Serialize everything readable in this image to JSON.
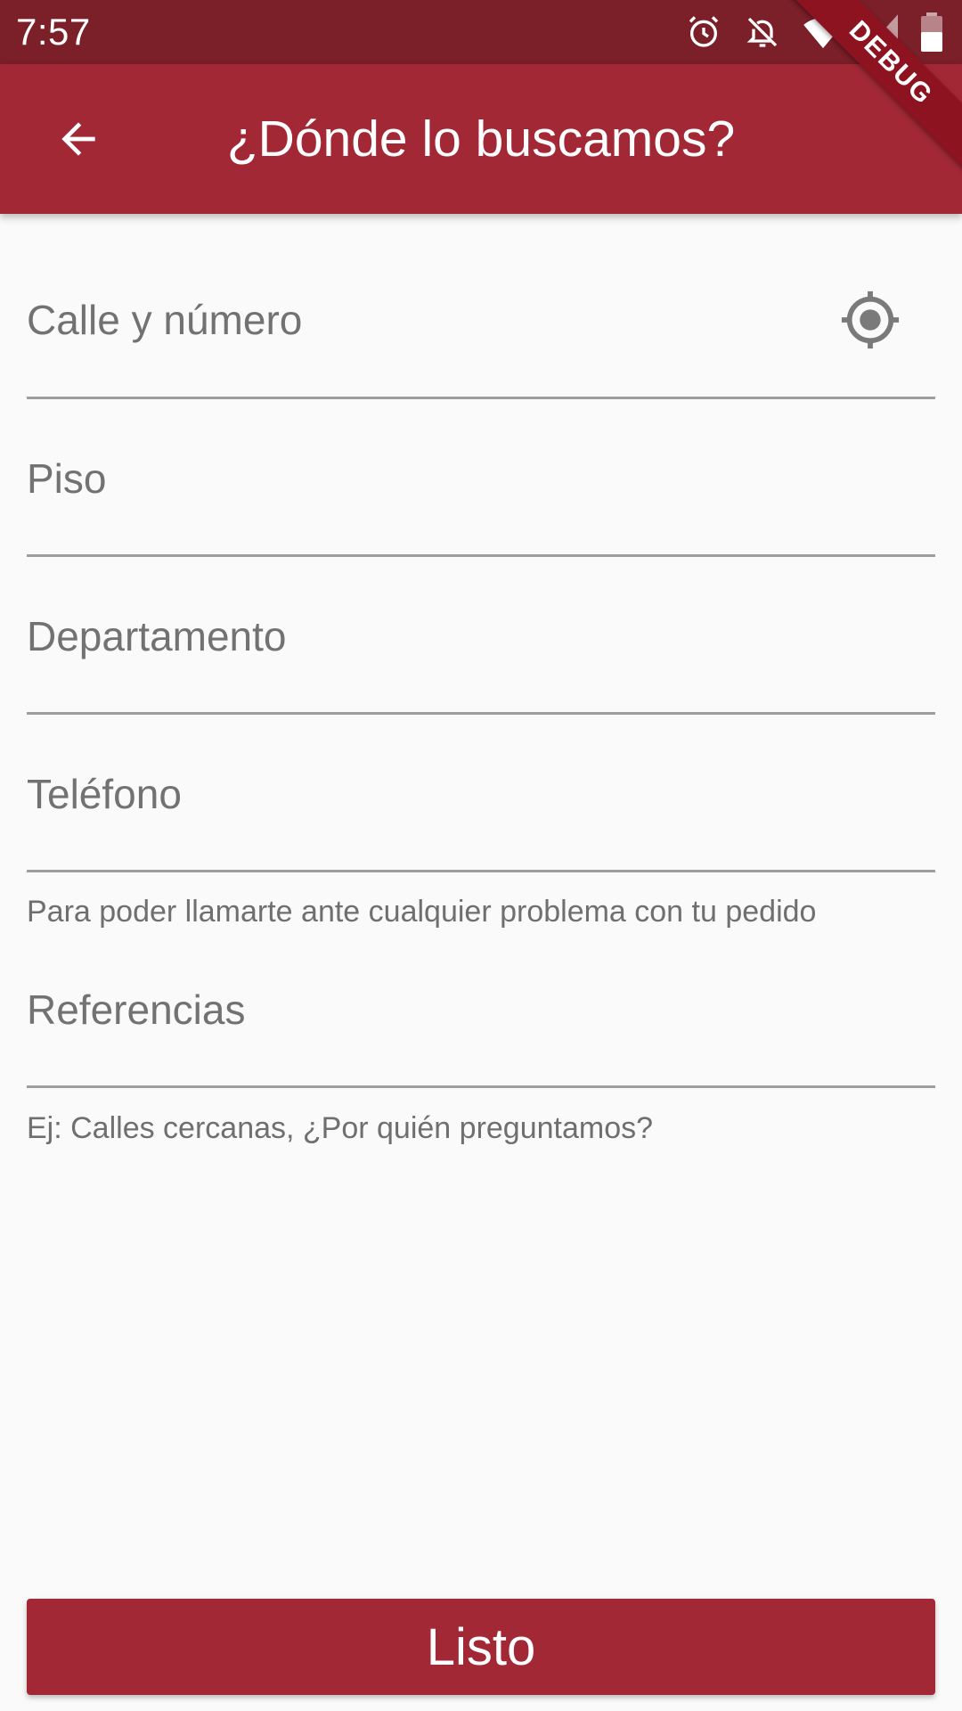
{
  "status_bar": {
    "time": "7:57",
    "icons": [
      "alarm-icon",
      "notifications-off-icon",
      "wifi-icon",
      "signal-icon",
      "battery-icon"
    ]
  },
  "app_bar": {
    "title": "¿Dónde lo buscamos?",
    "back_icon": "arrow-back-icon"
  },
  "debug_banner": "DEBUG",
  "form": {
    "street": {
      "label": "Calle y número",
      "value": "",
      "icon": "my-location-icon"
    },
    "floor": {
      "label": "Piso",
      "value": ""
    },
    "apartment": {
      "label": "Departamento",
      "value": ""
    },
    "phone": {
      "label": "Teléfono",
      "value": "",
      "helper": "Para poder llamarte ante cualquier problema con tu pedido"
    },
    "references": {
      "label": "Referencias",
      "value": "",
      "helper": "Ej: Calles cercanas, ¿Por quién preguntamos?"
    }
  },
  "submit_label": "Listo",
  "colors": {
    "primary": "#a32836",
    "status_bar": "#7b1f29",
    "debug": "#8e1320"
  }
}
